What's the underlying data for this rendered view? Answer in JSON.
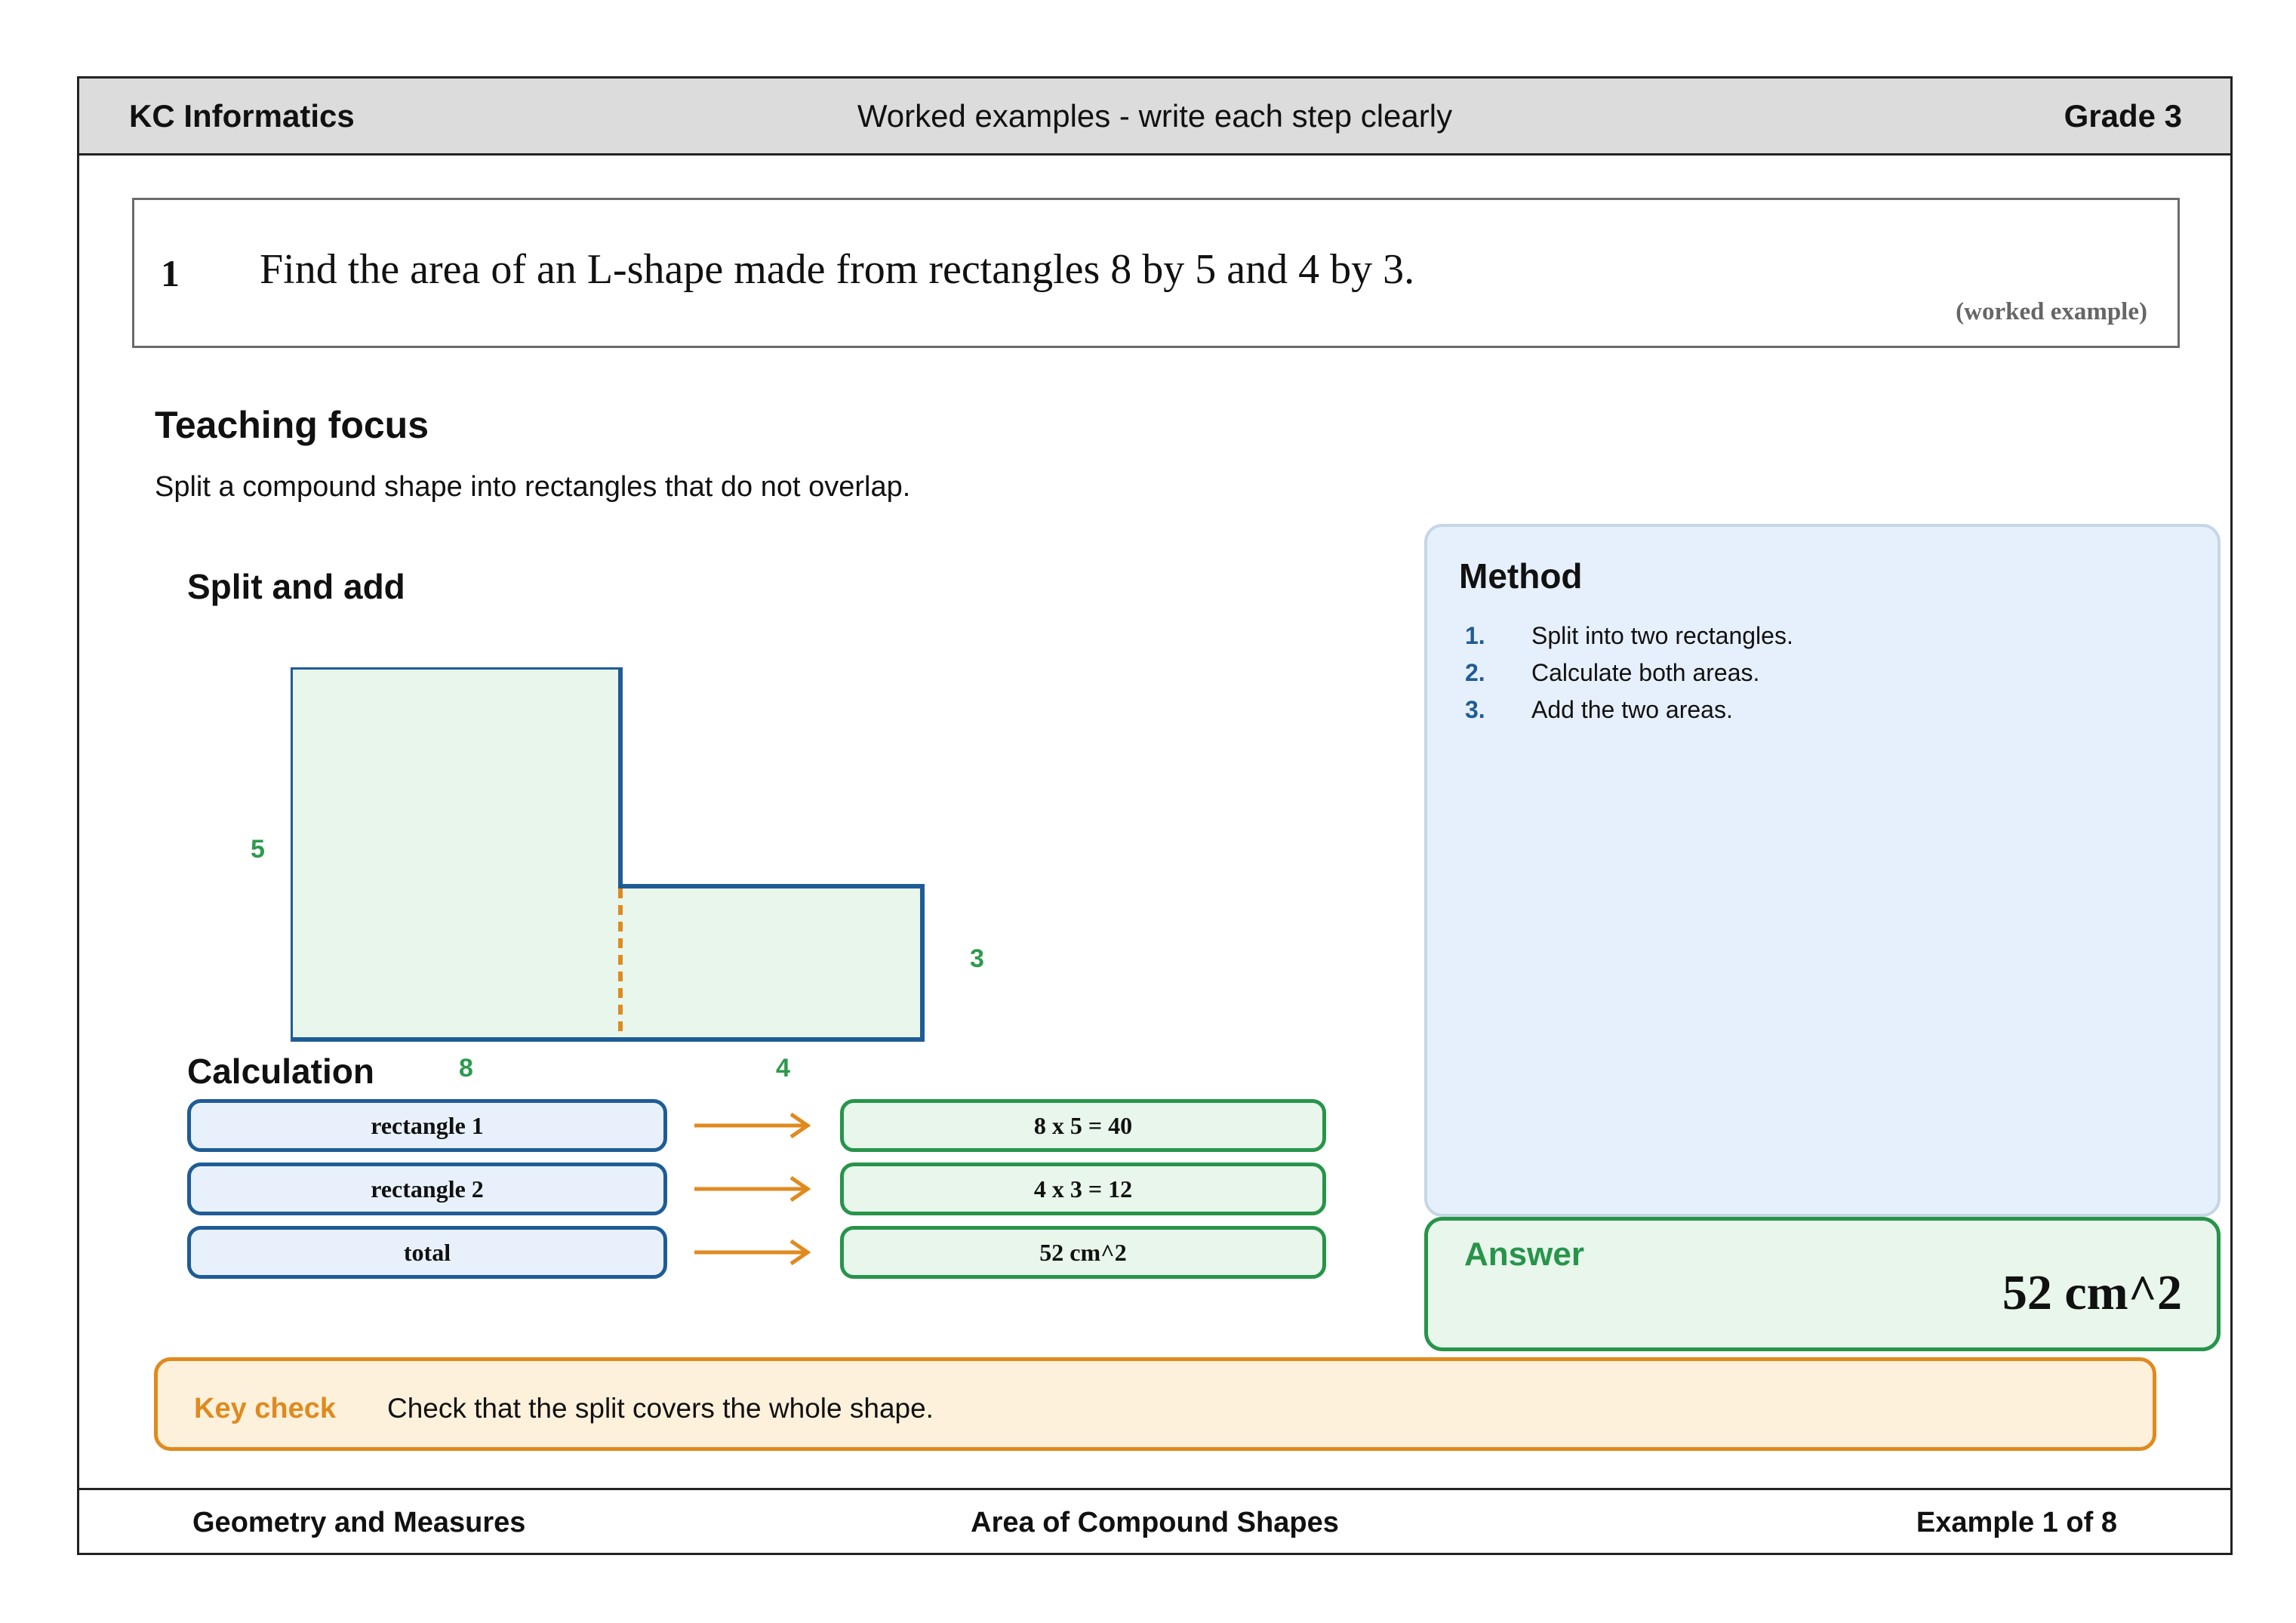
{
  "header": {
    "brand": "KC Informatics",
    "subtitle": "Worked examples - write each step clearly",
    "grade": "Grade 3"
  },
  "question": {
    "number": "1",
    "text": "Find the area of an L-shape made from rectangles 8 by 5 and 4 by 3.",
    "tag": "(worked example)"
  },
  "teaching_focus": {
    "title": "Teaching focus",
    "text": "Split a compound shape into rectangles that do not overlap."
  },
  "diagram": {
    "title": "Split and add",
    "labels": {
      "left_height": "5",
      "right_height": "3",
      "left_width": "8",
      "right_width": "4"
    },
    "colors": {
      "outline": "#1f5c96",
      "fill": "#e8f6ec",
      "split_line": "#e08a1e",
      "dimension": "#2e9a4e"
    }
  },
  "calculation": {
    "title": "Calculation",
    "rows": [
      {
        "label": "rectangle 1",
        "result": "8 x 5 = 40"
      },
      {
        "label": "rectangle 2",
        "result": "4 x 3 = 12"
      },
      {
        "label": "total",
        "result": "52 cm^2"
      }
    ]
  },
  "method": {
    "title": "Method",
    "steps": [
      {
        "num": "1.",
        "text": "Split into two rectangles."
      },
      {
        "num": "2.",
        "text": "Calculate both areas."
      },
      {
        "num": "3.",
        "text": "Add the two areas."
      }
    ]
  },
  "answer": {
    "label": "Answer",
    "value": "52 cm^2"
  },
  "key_check": {
    "label": "Key check",
    "text": "Check that the split covers the whole shape."
  },
  "footer": {
    "strand": "Geometry and Measures",
    "topic": "Area of Compound Shapes",
    "progress": "Example 1 of 8"
  }
}
